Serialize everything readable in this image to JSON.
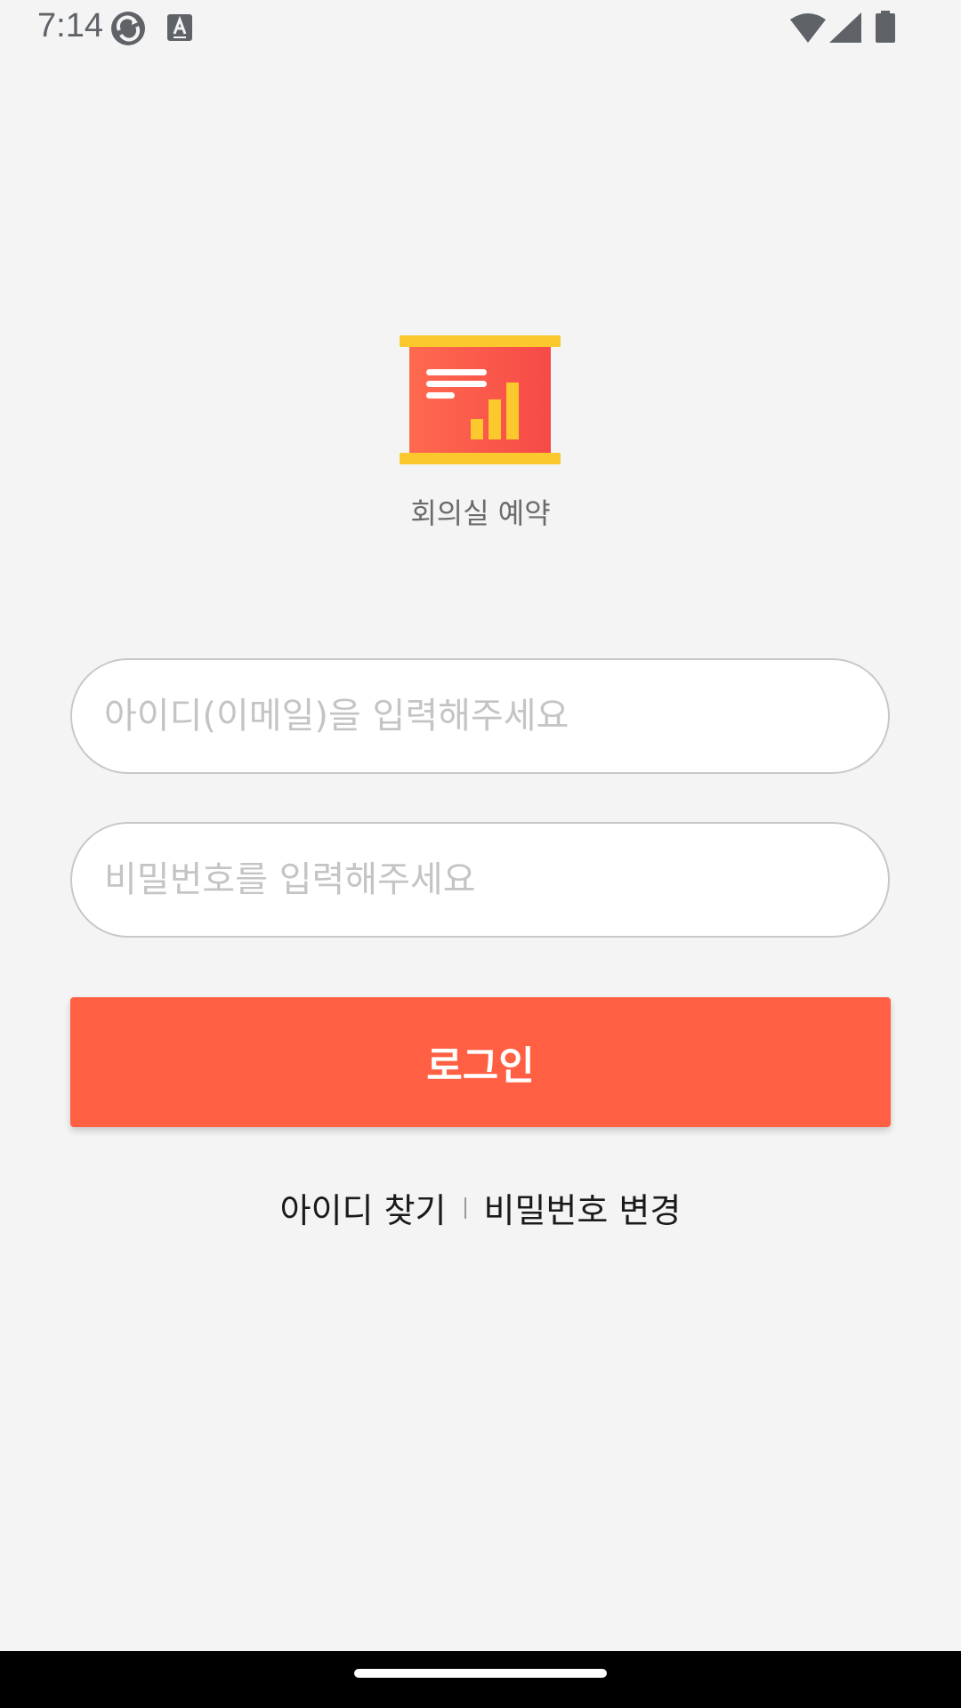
{
  "status_bar": {
    "time": "7:14",
    "icons": [
      "sync-icon",
      "a-notification-icon",
      "wifi-icon",
      "cell-signal-icon",
      "battery-icon"
    ]
  },
  "app": {
    "logo_icon": "presentation-board-icon",
    "name": "회의실 예약"
  },
  "form": {
    "id_placeholder": "아이디(이메일)을 입력해주세요",
    "password_placeholder": "비밀번호를 입력해주세요",
    "login_label": "로그인"
  },
  "links": {
    "find_id": "아이디 찾기",
    "change_password": "비밀번호 변경"
  },
  "colors": {
    "background": "#f4f4f4",
    "accent": "#ff5f43",
    "logo_yellow": "#fbc92e",
    "logo_red": "#f7534a"
  }
}
